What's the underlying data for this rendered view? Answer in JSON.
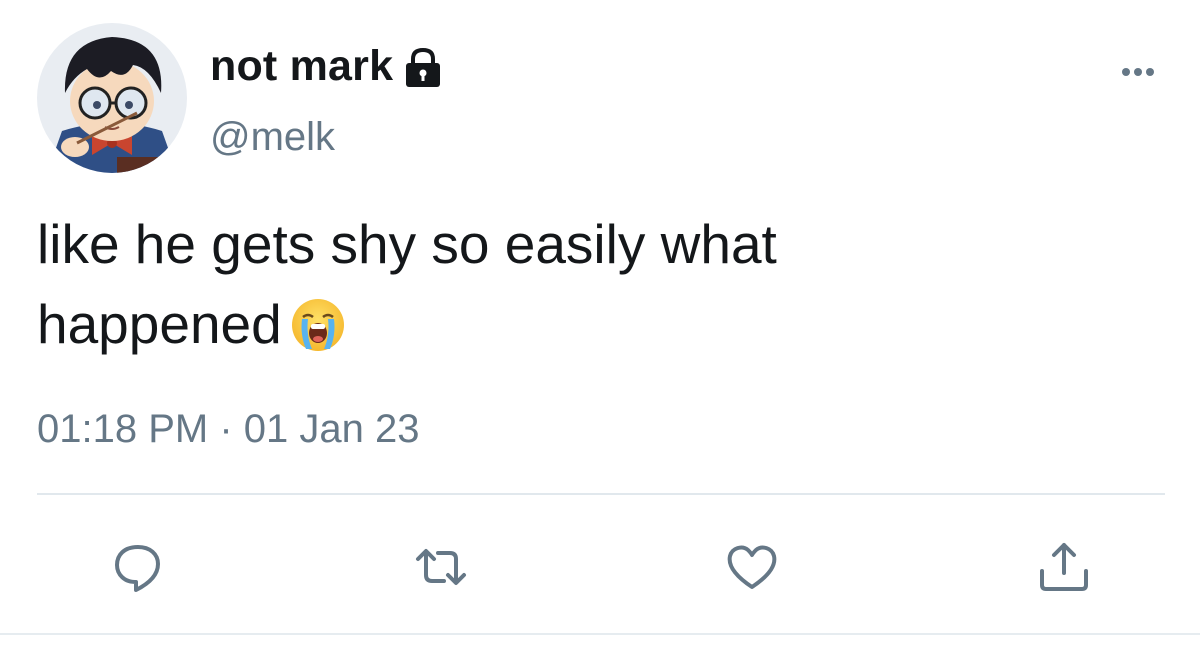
{
  "author": {
    "display_name": "not mark",
    "handle": "@melk",
    "protected": true,
    "avatar": "anime-character-with-glasses-avatar"
  },
  "tweet": {
    "text_line_1": "like he gets shy so easily what",
    "text_line_2": "happened",
    "emoji": "loudly-crying-face",
    "time": "01:18 PM",
    "separator": "·",
    "date": "01 Jan 23"
  },
  "icons": {
    "lock": "lock-icon",
    "more": "more-horizontal-icon",
    "reply": "reply-icon",
    "retweet": "retweet-icon",
    "like": "heart-icon",
    "share": "share-icon"
  },
  "colors": {
    "text_primary": "#14171a",
    "text_secondary": "#657786",
    "divider": "#e1e8ed"
  }
}
